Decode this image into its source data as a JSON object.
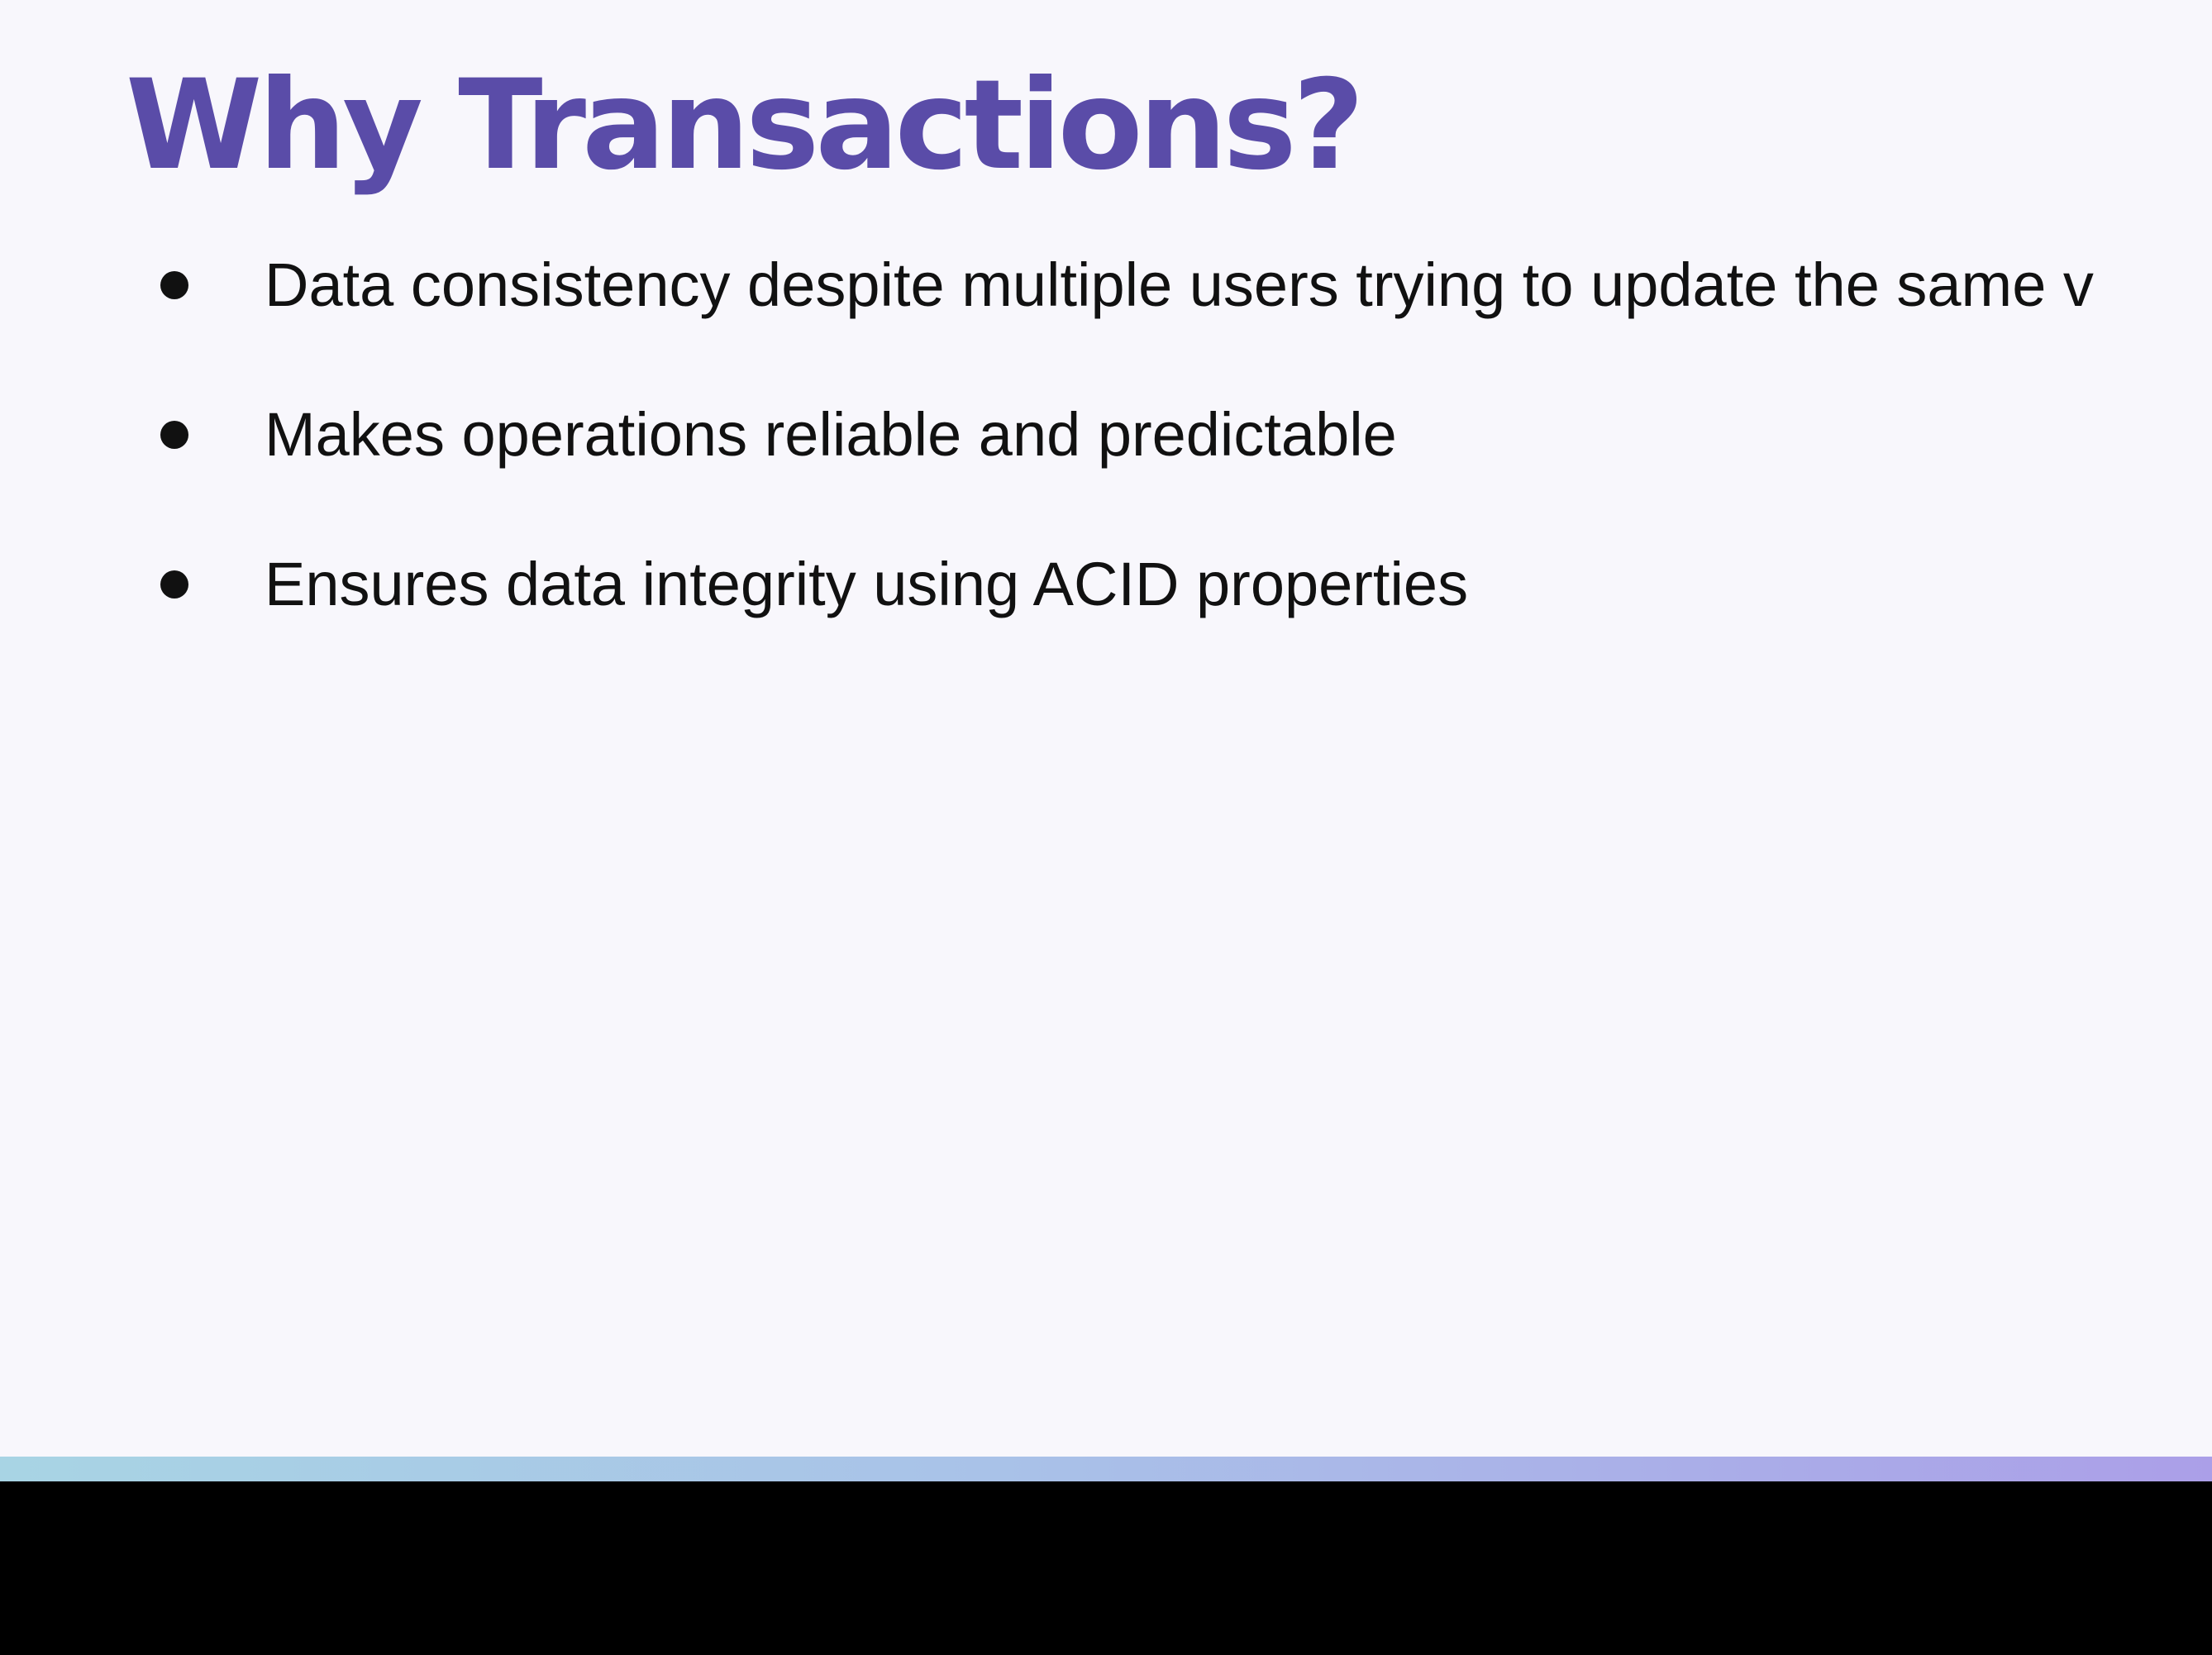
{
  "slide": {
    "title": "Why Transactions?",
    "bullets": [
      "Data consistency despite multiple users trying to update the same v",
      "Makes operations reliable and predictable",
      "Ensures data integrity using ACID properties"
    ]
  },
  "colors": {
    "title": "#5a4ca8",
    "background": "#f8f7fc",
    "text": "#111111",
    "accent_bar_start": "#a8d4e4",
    "accent_bar_end": "#ab9fe8",
    "bottom_band": "#000000"
  }
}
